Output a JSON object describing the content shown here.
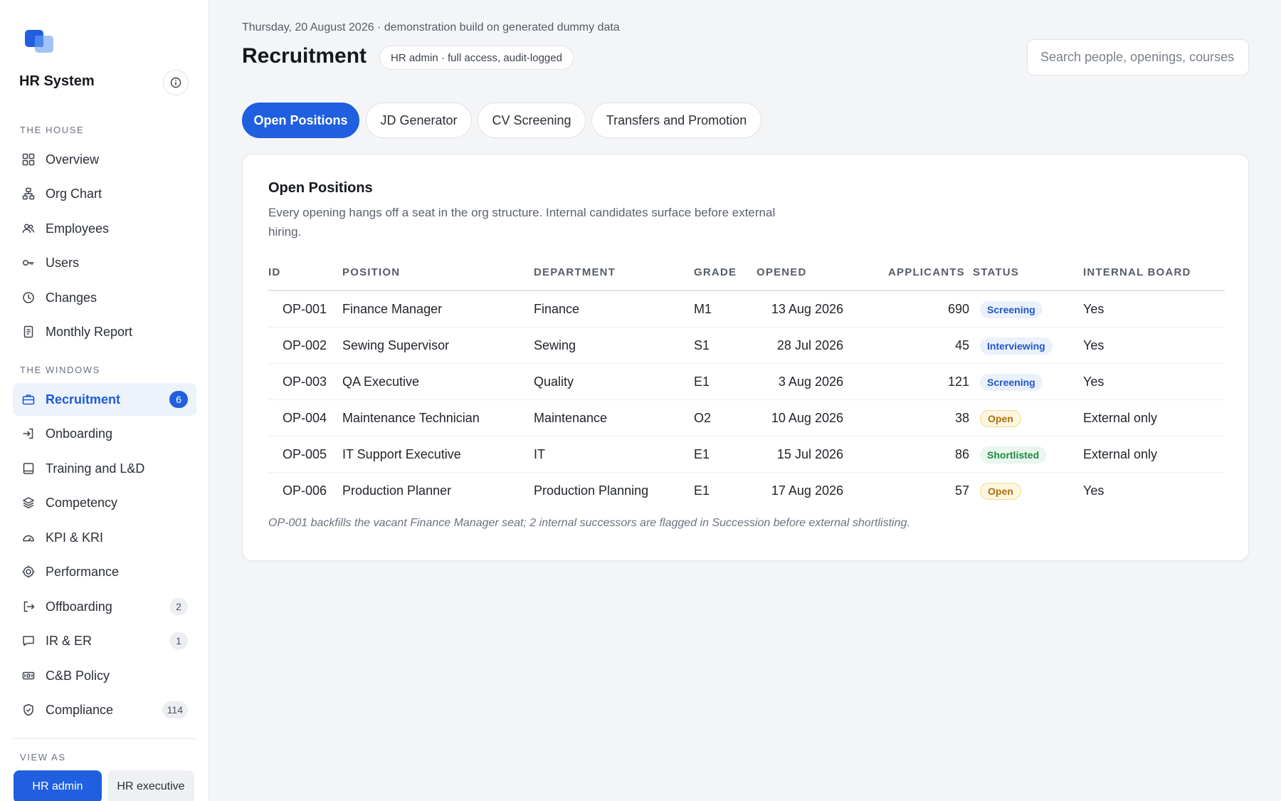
{
  "app": {
    "title": "HR System"
  },
  "sidebar": {
    "sections": [
      {
        "label": "THE HOUSE"
      },
      {
        "label": "THE WINDOWS"
      },
      {
        "label": "VIEW AS"
      }
    ],
    "items": [
      {
        "label": "Overview",
        "icon": "grid-icon"
      },
      {
        "label": "Org Chart",
        "icon": "org-chart-icon"
      },
      {
        "label": "Employees",
        "icon": "users-icon"
      },
      {
        "label": "Users",
        "icon": "key-icon"
      },
      {
        "label": "Changes",
        "icon": "clock-icon"
      },
      {
        "label": "Monthly Report",
        "icon": "document-icon"
      },
      {
        "label": "Recruitment",
        "icon": "briefcase-icon",
        "badge": "6",
        "active": true
      },
      {
        "label": "Onboarding",
        "icon": "login-icon"
      },
      {
        "label": "Training and L&D",
        "icon": "book-icon"
      },
      {
        "label": "Competency",
        "icon": "layers-icon"
      },
      {
        "label": "KPI & KRI",
        "icon": "gauge-icon"
      },
      {
        "label": "Performance",
        "icon": "target-icon"
      },
      {
        "label": "Offboarding",
        "icon": "logout-icon",
        "badge": "2"
      },
      {
        "label": "IR & ER",
        "icon": "chat-icon",
        "badge": "1"
      },
      {
        "label": "C&B Policy",
        "icon": "money-icon"
      },
      {
        "label": "Compliance",
        "icon": "shield-icon",
        "badge": "114"
      }
    ],
    "view_as": {
      "primary": "HR admin",
      "secondary": "HR executive"
    }
  },
  "header": {
    "meta": "Thursday, 20 August 2026 · demonstration build on generated dummy data",
    "title": "Recruitment",
    "role_chip": "HR admin · full access, audit-logged",
    "search_placeholder": "Search people, openings, courses"
  },
  "tabs": [
    {
      "label": "Open Positions",
      "active": true
    },
    {
      "label": "JD Generator"
    },
    {
      "label": "CV Screening"
    },
    {
      "label": "Transfers and Promotion"
    }
  ],
  "card": {
    "title": "Open Positions",
    "description": "Every opening hangs off a seat in the org structure. Internal candidates surface before external hiring.",
    "columns": [
      "ID",
      "POSITION",
      "DEPARTMENT",
      "GRADE",
      "OPENED",
      "APPLICANTS",
      "STATUS",
      "INTERNAL BOARD"
    ],
    "rows": [
      {
        "id": "OP-001",
        "position": "Finance Manager",
        "department": "Finance",
        "grade": "M1",
        "opened": "13 Aug 2026",
        "applicants": "690",
        "status": "Screening",
        "internal": "Yes"
      },
      {
        "id": "OP-002",
        "position": "Sewing Supervisor",
        "department": "Sewing",
        "grade": "S1",
        "opened": "28 Jul 2026",
        "applicants": "45",
        "status": "Interviewing",
        "internal": "Yes"
      },
      {
        "id": "OP-003",
        "position": "QA Executive",
        "department": "Quality",
        "grade": "E1",
        "opened": "3 Aug 2026",
        "applicants": "121",
        "status": "Screening",
        "internal": "Yes"
      },
      {
        "id": "OP-004",
        "position": "Maintenance Technician",
        "department": "Maintenance",
        "grade": "O2",
        "opened": "10 Aug 2026",
        "applicants": "38",
        "status": "Open",
        "internal": "External only"
      },
      {
        "id": "OP-005",
        "position": "IT Support Executive",
        "department": "IT",
        "grade": "E1",
        "opened": "15 Jul 2026",
        "applicants": "86",
        "status": "Shortlisted",
        "internal": "External only"
      },
      {
        "id": "OP-006",
        "position": "Production Planner",
        "department": "Production Planning",
        "grade": "E1",
        "opened": "17 Aug 2026",
        "applicants": "57",
        "status": "Open",
        "internal": "Yes"
      }
    ],
    "footnote": "OP-001 backfills the vacant Finance Manager seat; 2 internal successors are flagged in Succession before external shortlisting."
  },
  "colors": {
    "accent": "#1f5fe0",
    "active_nav_bg": "#edf3fd",
    "status_blue": "#2156c6",
    "status_amber": "#a9700d",
    "status_green": "#1c8a45"
  }
}
